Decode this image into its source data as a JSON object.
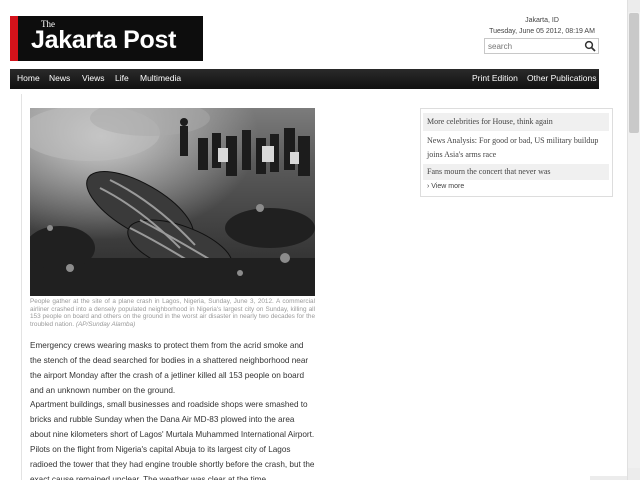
{
  "header": {
    "logo_small": "The",
    "logo_main": "Jakarta Post",
    "location": "Jakarta, ID",
    "datetime": "Tuesday, June 05 2012, 08:19 AM",
    "search_placeholder": "search"
  },
  "nav": {
    "left": [
      "Home",
      "News",
      "Views",
      "Life",
      "Multimedia"
    ],
    "right": [
      "Print Edition",
      "Other Publications"
    ]
  },
  "article": {
    "caption_text": "People gather at the site of a plane crash in Lagos, Nigeria, Sunday, June 3, 2012. A commercial airliner crashed into a densely populated neighborhood in Nigeria's largest city on Sunday, killing all 153 people on board and others on the ground in the worst air disaster in nearly two decades for the troubled nation.",
    "caption_credit": "(AP/Sunday Alamba)",
    "paragraphs": [
      "Emergency crews wearing masks to protect them from the acrid smoke and the stench of the dead searched for bodies in a shattered neighborhood near the airport Monday after the crash of a jetliner killed all 153 people on board and an unknown number on the ground.",
      "Apartment buildings, small businesses and roadside shops were smashed to bricks and rubble Sunday when the Dana Air MD-83 plowed into the area about nine kilometers short of Lagos' Murtala Muhammed International Airport.",
      "Pilots on the flight from Nigeria's capital Abuja to its largest city of Lagos radioed the tower that they had engine trouble shortly before the crash, but the exact cause remained unclear. The weather was clear at the time."
    ]
  },
  "sidebar": {
    "items": [
      "More celebrities for House, think again",
      "News Analysis: For good or bad, US military buildup joins Asia's arms race",
      "Fans mourn the concert that never was"
    ],
    "view_more": "View more"
  },
  "colors": {
    "logo_red": "#d3121a",
    "nav_bg": "#1a1a1a",
    "sidebar_stripe": "#f0f0f0"
  }
}
